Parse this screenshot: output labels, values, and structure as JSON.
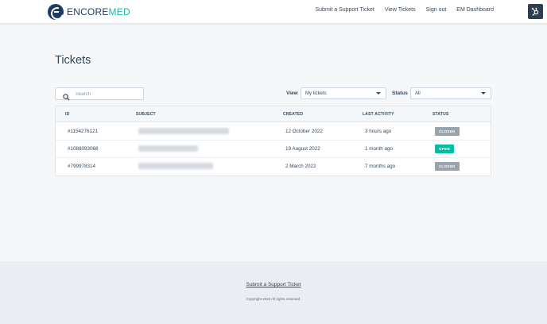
{
  "header": {
    "logo_primary": "ENCORE",
    "logo_accent": "MED",
    "nav": [
      {
        "label": "Submit a Support Ticket"
      },
      {
        "label": "View Tickets"
      },
      {
        "label": "Sign out"
      },
      {
        "label": "EM Dashboard"
      }
    ],
    "icon": "hubspot-sprocket-icon"
  },
  "page": {
    "title": "Tickets"
  },
  "filters": {
    "search_placeholder": "Search",
    "view_label": "View",
    "view_value": "My tickets",
    "status_label": "Status",
    "status_value": "All"
  },
  "table": {
    "columns": [
      "ID",
      "SUBJECT",
      "CREATED",
      "LAST ACTIVITY",
      "STATUS"
    ],
    "rows": [
      {
        "id": "#1154276121",
        "created": "12 October 2022",
        "last_activity": "3 hours ago",
        "status": "CLOSED"
      },
      {
        "id": "#1088093068",
        "created": "19 August 2022",
        "last_activity": "1 month ago",
        "status": "OPEN"
      },
      {
        "id": "#799978314",
        "created": "2 March 2022",
        "last_activity": "7 months ago",
        "status": "CLOSED"
      }
    ]
  },
  "footer": {
    "link": "Submit a Support Ticket",
    "copyright": "Copyright 2022 All rights reserved."
  },
  "colors": {
    "brand_dark": "#1f3a5f",
    "brand_accent": "#1fb3a6",
    "status_open": "#00bda5",
    "status_closed": "#99a3ad"
  }
}
